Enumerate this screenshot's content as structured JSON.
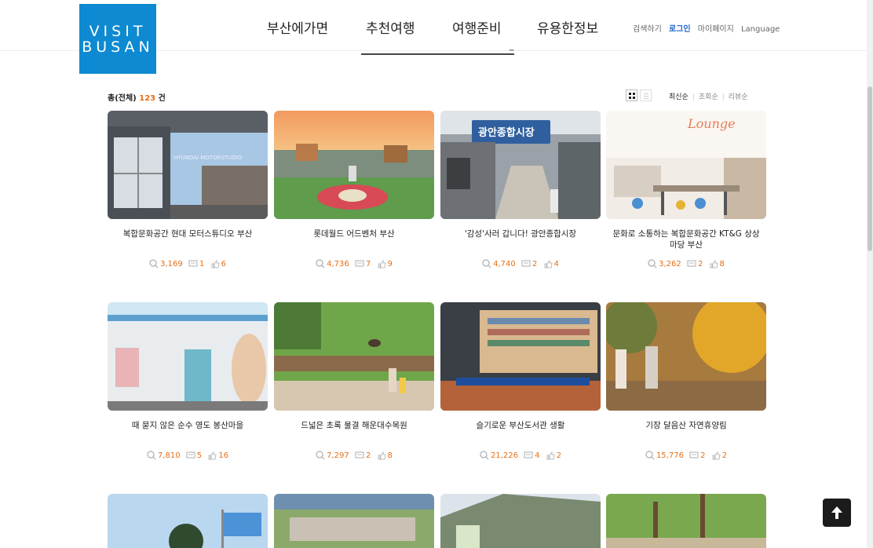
{
  "logo": {
    "line1": "VISIT",
    "line2": "BUSAN"
  },
  "nav": {
    "items": [
      {
        "label": "부산에가면"
      },
      {
        "label": "추천여행"
      },
      {
        "label": "여행준비"
      },
      {
        "label": "유용한정보"
      }
    ]
  },
  "util": {
    "search": "검색하기",
    "login": "로그인",
    "mypage": "마이페이지",
    "language": "Language"
  },
  "summary": {
    "prefix": "총(전체) ",
    "count": "123",
    "suffix": " 건"
  },
  "sort": {
    "latest": "최신순",
    "views": "조회순",
    "reviews": "리뷰순"
  },
  "colors": {
    "accent": "#e76f16",
    "brand": "#0d8ad1",
    "link": "#1e64c8"
  },
  "icons": {
    "views": "magnifier-icon",
    "comments": "comment-icon",
    "likes": "thumbs-up-icon",
    "grid_view": "grid-view-icon",
    "list_view": "list-view-icon",
    "top": "arrow-up-icon"
  },
  "items": [
    {
      "title": "복합문화공간 현대 모터스튜디오 부산",
      "views": "3,169",
      "comments": "1",
      "likes": "6"
    },
    {
      "title": "롯데월드 어드벤처 부산",
      "views": "4,736",
      "comments": "7",
      "likes": "9"
    },
    {
      "title": "'감성'사러 갑니다! 광안종합시장",
      "views": "4,740",
      "comments": "2",
      "likes": "4"
    },
    {
      "title": "문화로 소통하는 복합문화공간 KT&G 상상마당 부산",
      "views": "3,262",
      "comments": "2",
      "likes": "8"
    },
    {
      "title": "때 묻지 않은 순수 영도 봉산마을",
      "views": "7,810",
      "comments": "5",
      "likes": "16"
    },
    {
      "title": "드넓은 초록 물결 해운대수목원",
      "views": "7,297",
      "comments": "2",
      "likes": "8"
    },
    {
      "title": "슬기로운 부산도서관 생활",
      "views": "21,226",
      "comments": "4",
      "likes": "2"
    },
    {
      "title": "기장 달음산 자연휴양림",
      "views": "15,776",
      "comments": "2",
      "likes": "2"
    }
  ],
  "photo_text": {
    "card1_sign": "HYUNDAI MOTORSTUDIO BUSAN",
    "card3_sign": "광안종합시장",
    "card4_sign": "Lounge"
  }
}
